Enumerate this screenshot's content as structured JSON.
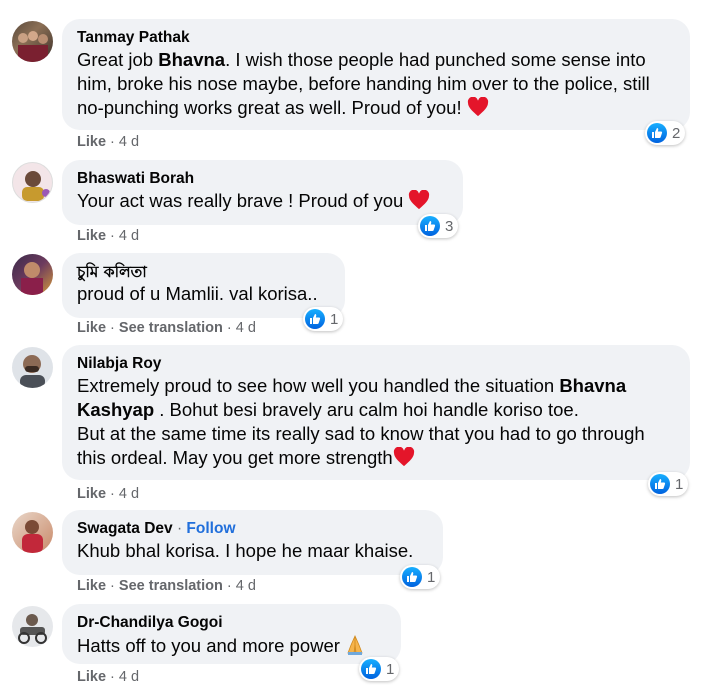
{
  "colors": {
    "bubble": "#f0f2f5",
    "like_blue": "#1877f2",
    "meta_gray": "#65676b",
    "follow": "#216fdb",
    "heart": "#e4152a"
  },
  "ui": {
    "like_label": "Like",
    "see_translation_label": "See translation",
    "follow_label": "Follow",
    "separator": "·"
  },
  "comments": [
    {
      "author": "Tanmay Pathak",
      "text_before": "Great job ",
      "mention": "Bhavna",
      "text_after": ". I wish those people had punched some sense into him, broke his nose maybe, before handing him over to the police, still no-punching works great as well. Proud of you! ",
      "emoji": "red-heart",
      "time": "4 d",
      "reactions": "2"
    },
    {
      "author": "Bhaswati Borah",
      "text": "Your act was really brave ! Proud of you ",
      "emoji": "red-heart",
      "time": "4 d",
      "reactions": "3"
    },
    {
      "author": "চুমি কলিতা",
      "text": "proud of u Mamlii. val korisa..",
      "time": "4 d",
      "reactions": "1",
      "see_translation": true
    },
    {
      "author": "Nilabja Roy",
      "text_before": "Extremely proud to see how well you handled the situation ",
      "mention": "Bhavna Kashyap",
      "text_after": " . Bohut besi bravely aru calm hoi handle koriso toe.",
      "text_line3": "But at the same time its really sad to know that you had to go through this ordeal. May you get more strength",
      "emoji": "red-heart",
      "time": "4 d",
      "reactions": "1"
    },
    {
      "author": "Swagata Dev",
      "follow": true,
      "text": "Khub bhal korisa. I hope he maar khaise.",
      "time": "4 d",
      "reactions": "1",
      "see_translation": true
    },
    {
      "author": "Dr-Chandilya Gogoi",
      "text": "Hatts off to you and more power ",
      "emoji": "folded-hands",
      "time": "4 d",
      "reactions": "1"
    }
  ]
}
